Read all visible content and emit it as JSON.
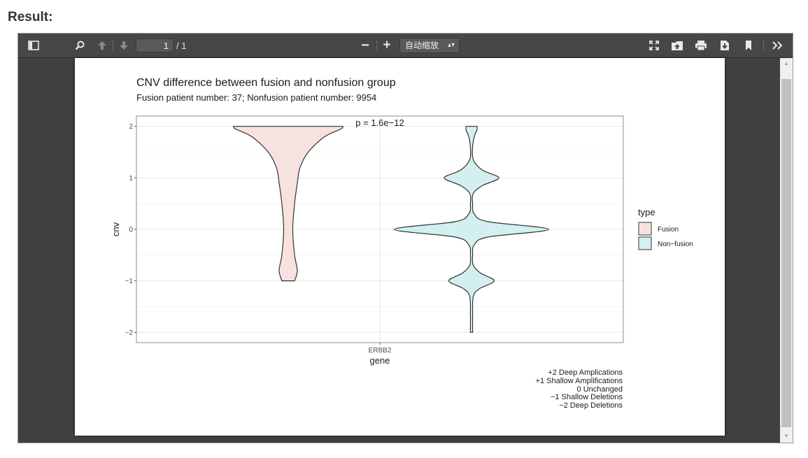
{
  "heading": "Result:",
  "toolbar": {
    "page_current": "1",
    "page_total": "/ 1",
    "zoom_minus": "−",
    "zoom_plus": "+",
    "zoom_value": "自动缩放"
  },
  "figure": {
    "title": "CNV difference between fusion and nonfusion group",
    "subtitle": "Fusion patient number: 37; Nonfusion patient number: 9954",
    "annotation": "p = 1.6e−12",
    "notes": [
      "+2 Deep Amplications",
      "+1 Shallow Amplifications",
      "0 Unchanged",
      "−1 Shallow Deletions",
      "−2 Deep Deletions"
    ]
  },
  "chart_data": {
    "type": "violin",
    "xlabel": "gene",
    "ylabel": "cnv",
    "categories": [
      "ERBB2"
    ],
    "ylim": [
      -2.2,
      2.2
    ],
    "yticks": [
      -2,
      -1,
      0,
      1,
      2
    ],
    "ytick_labels": [
      "−2",
      "−1",
      "0",
      "1",
      "2"
    ],
    "legend_title": "type",
    "legend_position": "right",
    "grid": true,
    "series": [
      {
        "name": "Fusion",
        "fill": "#f8e2e0",
        "y_range": [
          -1,
          2
        ],
        "density": [
          [
            -1,
            0.07
          ],
          [
            -0.8,
            0.1
          ],
          [
            -0.5,
            0.07
          ],
          [
            0,
            0.05
          ],
          [
            0.5,
            0.07
          ],
          [
            0.9,
            0.1
          ],
          [
            1.2,
            0.13
          ],
          [
            1.5,
            0.22
          ],
          [
            1.8,
            0.4
          ],
          [
            1.95,
            0.58
          ],
          [
            2,
            0.6
          ]
        ]
      },
      {
        "name": "Non−fusion",
        "fill": "#d4efef",
        "y_range": [
          -2,
          2
        ],
        "density": [
          [
            -2,
            0.012
          ],
          [
            -1.65,
            0.012
          ],
          [
            -1.3,
            0.02
          ],
          [
            -1.15,
            0.09
          ],
          [
            -1,
            0.25
          ],
          [
            -0.85,
            0.1
          ],
          [
            -0.7,
            0.02
          ],
          [
            -0.5,
            0.012
          ],
          [
            -0.3,
            0.03
          ],
          [
            -0.15,
            0.18
          ],
          [
            0,
            0.85
          ],
          [
            0.15,
            0.18
          ],
          [
            0.3,
            0.03
          ],
          [
            0.5,
            0.012
          ],
          [
            0.7,
            0.02
          ],
          [
            0.85,
            0.12
          ],
          [
            1,
            0.3
          ],
          [
            1.15,
            0.12
          ],
          [
            1.35,
            0.02
          ],
          [
            1.6,
            0.012
          ],
          [
            1.8,
            0.03
          ],
          [
            1.93,
            0.06
          ],
          [
            2,
            0.06
          ]
        ]
      }
    ]
  }
}
